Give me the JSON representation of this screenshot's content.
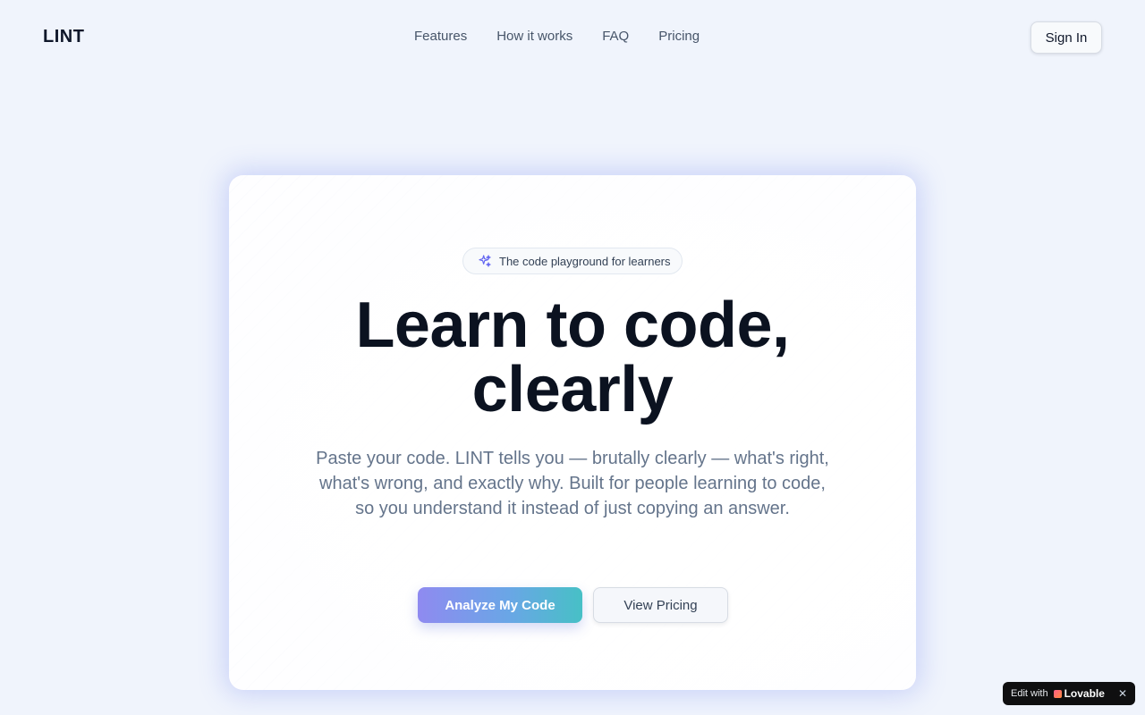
{
  "header": {
    "logo": "LINT",
    "nav": [
      {
        "label": "Features"
      },
      {
        "label": "How it works"
      },
      {
        "label": "FAQ"
      },
      {
        "label": "Pricing"
      }
    ],
    "signin_label": "Sign In"
  },
  "hero": {
    "badge_icon": "sparkles-icon",
    "badge_text": "The code playground for learners",
    "headline_line1": "Learn to code,",
    "headline_line2": "clearly",
    "subtext": "Paste your code. LINT tells you — brutally clearly — what's right, what's wrong, and exactly why. Built for people learning to code, so you understand it instead of just copying an answer.",
    "primary_cta": "Analyze My Code",
    "secondary_cta": "View Pricing"
  },
  "lovable_badge": {
    "prefix": "Edit with",
    "brand": "Lovable",
    "close": "✕"
  },
  "colors": {
    "background": "#f0f4fc",
    "accent_gradient_start": "#8f8af0",
    "accent_gradient_end": "#47c0c6",
    "headline": "#0b1220",
    "body_text": "#64748b"
  }
}
